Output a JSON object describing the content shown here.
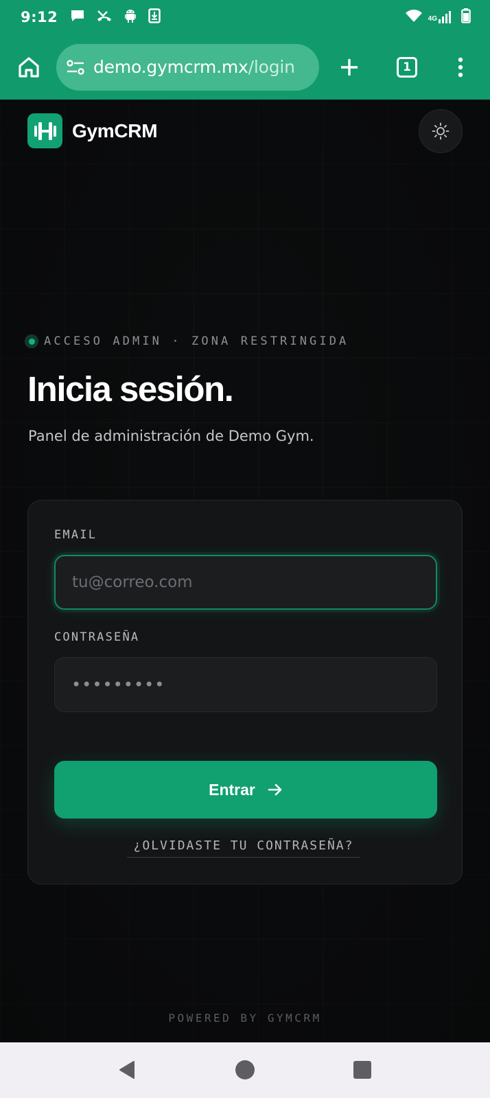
{
  "status_bar": {
    "time": "9:12",
    "network_label": "4G",
    "icons_left": [
      "message-icon",
      "missed-call-icon",
      "android-icon",
      "download-icon"
    ],
    "icons_right": [
      "wifi-icon",
      "signal-icon",
      "battery-icon"
    ]
  },
  "browser": {
    "url_host": "demo.gymcrm.mx",
    "url_path": "/login",
    "tab_count": "1"
  },
  "header": {
    "brand_name": "GymCRM"
  },
  "hero": {
    "eyebrow": "ACCESO ADMIN · ZONA RESTRINGIDA",
    "title": "Inicia sesión.",
    "subtitle": "Panel de administración de Demo Gym."
  },
  "form": {
    "email_label": "EMAIL",
    "email_placeholder": "tu@correo.com",
    "email_value": "",
    "password_label": "CONTRASEÑA",
    "password_value": "•••••••••",
    "submit_label": "Entrar",
    "forgot_link": "¿OLVIDASTE TU CONTRASEÑA?"
  },
  "footer": {
    "powered": "POWERED BY GYMCRM"
  },
  "colors": {
    "brand_green": "#119a6c",
    "accent": "#11a06f",
    "background": "#0b0c0d",
    "card": "#141517"
  }
}
